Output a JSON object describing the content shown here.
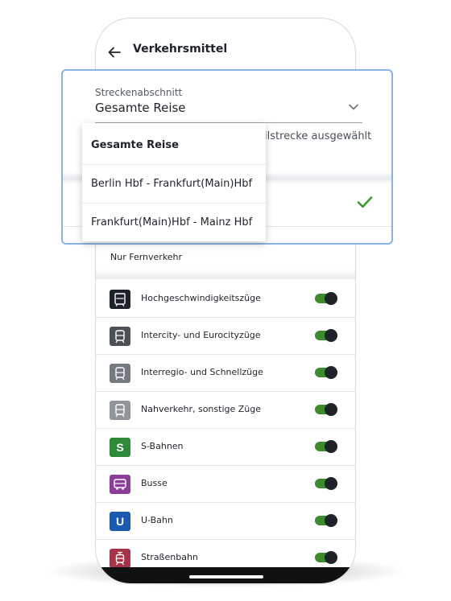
{
  "header": {
    "title": "Verkehrsmittel"
  },
  "filter": {
    "label": "Streckenabschnitt",
    "value": "Gesamte Reise",
    "hint": "ilstrecke ausgewählt",
    "options": [
      "Gesamte Reise",
      "Berlin Hbf - Frankfurt(Main)Hbf",
      "Frankfurt(Main)Hbf - Mainz Hbf"
    ]
  },
  "section": {
    "nur_fernverkehr": "Nur Fernverkehr"
  },
  "transport_modes": [
    {
      "label": "Hochgeschwindigkeitszüge",
      "icon": "ice-train-icon",
      "color": "#1d2329",
      "enabled": true
    },
    {
      "label": "Intercity- und Eurocityzüge",
      "icon": "intercity-train-icon",
      "color": "#4b5157",
      "enabled": true
    },
    {
      "label": "Interregio- und Schnellzüge",
      "icon": "regional-train-icon",
      "color": "#737a81",
      "enabled": true
    },
    {
      "label": "Nahverkehr, sonstige Züge",
      "icon": "local-train-icon",
      "color": "#8f959b",
      "enabled": true
    },
    {
      "label": "S-Bahnen",
      "icon": "s-bahn-icon",
      "symbol": "S",
      "color": "#2f8a3a",
      "enabled": true
    },
    {
      "label": "Busse",
      "icon": "bus-icon",
      "color": "#8a3e98",
      "enabled": true
    },
    {
      "label": "U-Bahn",
      "icon": "u-bahn-icon",
      "symbol": "U",
      "color": "#1b59b0",
      "enabled": true
    },
    {
      "label": "Straßenbahn",
      "icon": "tram-icon",
      "color": "#a8324a",
      "enabled": true
    }
  ],
  "colors": {
    "toggle_on": "#3d8a2f",
    "check": "#3d9a2f",
    "focus_border": "#89b3e2"
  }
}
